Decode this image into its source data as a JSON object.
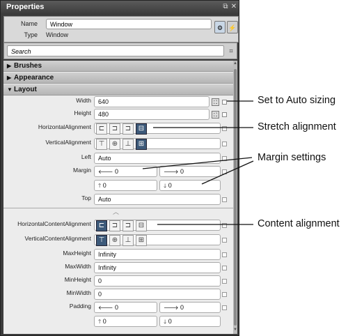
{
  "panel": {
    "title": "Properties",
    "header": {
      "name_label": "Name",
      "name_value": "Window",
      "type_label": "Type",
      "type_value": "Window"
    },
    "search": {
      "placeholder": "Search"
    },
    "categories": {
      "brushes": "Brushes",
      "appearance": "Appearance",
      "layout": "Layout"
    },
    "props": {
      "width": {
        "label": "Width",
        "value": "640"
      },
      "height": {
        "label": "Height",
        "value": "480"
      },
      "horizontal_alignment": {
        "label": "HorizontalAlignment"
      },
      "vertical_alignment": {
        "label": "VerticalAlignment"
      },
      "left": {
        "label": "Left",
        "value": "Auto"
      },
      "margin": {
        "label": "Margin",
        "left": "0",
        "right": "0",
        "top": "0",
        "bottom": "0"
      },
      "top": {
        "label": "Top",
        "value": "Auto"
      },
      "horizontal_content_alignment": {
        "label": "HorizontalContentAlignment"
      },
      "vertical_content_alignment": {
        "label": "VerticalContentAlignment"
      },
      "max_height": {
        "label": "MaxHeight",
        "value": "Infinity"
      },
      "max_width": {
        "label": "MaxWidth",
        "value": "Infinity"
      },
      "min_height": {
        "label": "MinHeight",
        "value": "0"
      },
      "min_width": {
        "label": "MinWidth",
        "value": "0"
      },
      "padding": {
        "label": "Padding",
        "left": "0",
        "right": "0",
        "top": "0",
        "bottom": "0"
      }
    }
  },
  "callouts": {
    "auto_sizing": "Set to Auto sizing",
    "stretch": "Stretch alignment",
    "margin": "Margin settings",
    "content": "Content alignment"
  },
  "colors": {
    "panel_bg": "#3c3c3c",
    "content_bg": "#ececec",
    "selected_align": "#3d5a7a"
  }
}
